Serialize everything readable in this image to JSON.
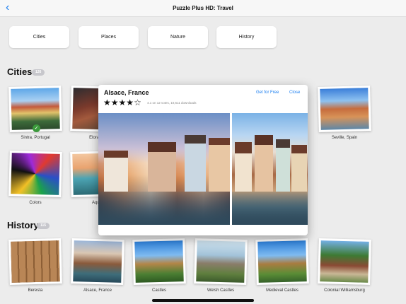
{
  "nav": {
    "back_icon": "chevron-left-icon",
    "title": "Puzzle Plus HD: Travel"
  },
  "categories": [
    "Cities",
    "Places",
    "Nature",
    "History"
  ],
  "sections": {
    "cities": {
      "title": "Cities",
      "count": "126",
      "tiles": [
        {
          "label": "Sintra, Portugal",
          "completed": true
        },
        {
          "label": "Elora, C"
        },
        {
          "label": "Seville, Spain"
        },
        {
          "label": "Colors"
        },
        {
          "label": "Aqua"
        }
      ]
    },
    "history": {
      "title": "History",
      "count": "115",
      "tiles": [
        {
          "label": "Beresta"
        },
        {
          "label": "Alsace, France"
        },
        {
          "label": "Castles"
        },
        {
          "label": "Welsh Castles"
        },
        {
          "label": "Medieval Castles"
        },
        {
          "label": "Colonial Williamsburg"
        }
      ]
    }
  },
  "popover": {
    "title": "Alsace, France",
    "get_label": "Get for Free",
    "close_label": "Close",
    "rating": 4,
    "rating_max": 5,
    "meta": "4.1 on 12 votes, 10,611 downloads"
  },
  "colors": {
    "accent": "#1a7ef0",
    "completed": "#3c9a3c",
    "badge": "#c7c7cc"
  }
}
